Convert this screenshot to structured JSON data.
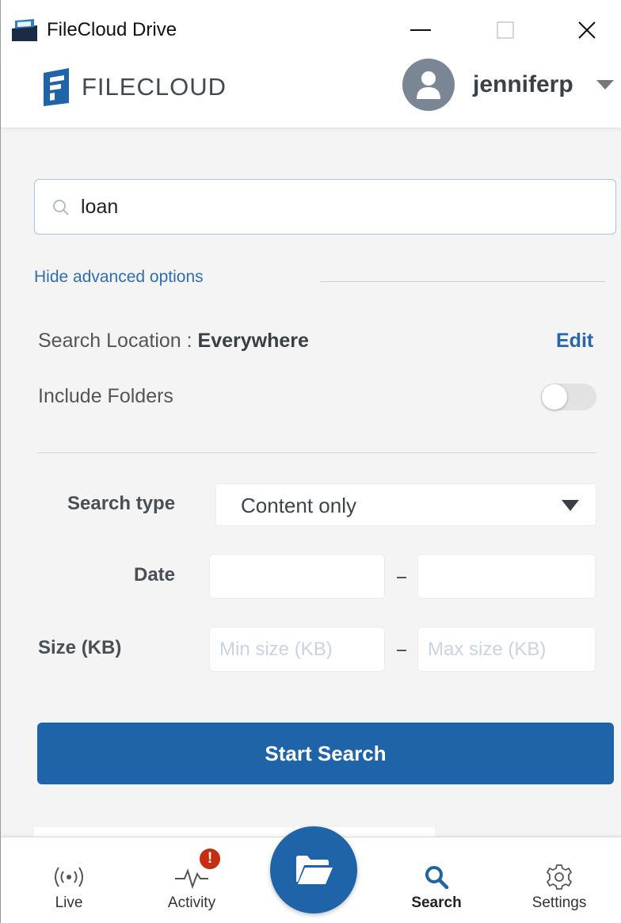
{
  "window": {
    "title": "FileCloud Drive",
    "controls": [
      "minimize-icon",
      "maximize-icon",
      "close-icon"
    ]
  },
  "header": {
    "logo_text": "FILECLOUD",
    "username": "jenniferp"
  },
  "search": {
    "value": "loan",
    "icon": "search-icon"
  },
  "advanced": {
    "toggle_label": "Hide advanced options",
    "location_label": "Search Location : ",
    "location_value": "Everywhere",
    "edit_label": "Edit",
    "include_folders_label": "Include Folders",
    "include_folders_on": false,
    "search_type_label": "Search type",
    "search_type_value": "Content only",
    "date_label": "Date",
    "date_from": "",
    "date_to": "",
    "size_label": "Size (KB)",
    "size_min_placeholder": "Min size (KB)",
    "size_max_placeholder": "Max size (KB)",
    "start_button": "Start Search"
  },
  "bottom_nav": {
    "live": "Live",
    "activity": "Activity",
    "activity_badge": "!",
    "search": "Search",
    "settings": "Settings",
    "active": "search"
  },
  "colors": {
    "primary": "#1f63a8",
    "link": "#2f6eb3",
    "badge": "#c62d12",
    "avatar": "#7a8694"
  }
}
